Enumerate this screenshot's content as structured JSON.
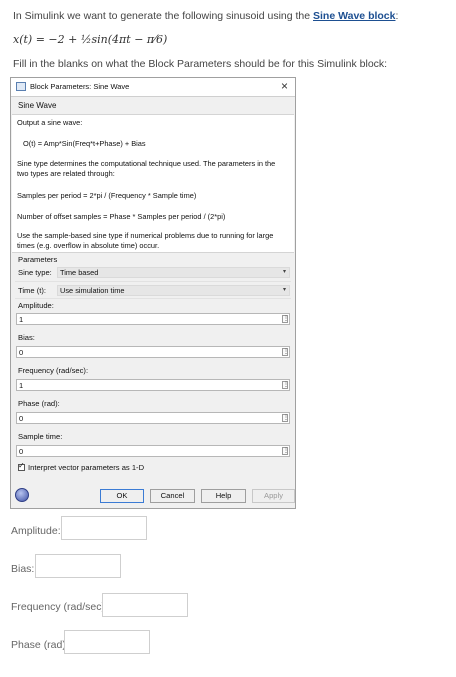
{
  "question": {
    "intro_prefix": "In Simulink we want to generate the following sinusoid using the ",
    "intro_link": "Sine Wave block",
    "intro_suffix": ":",
    "equation": "x(t) = −2 + ½sin(4πt − π⁄6)",
    "instruction": "Fill in the blanks on what the Block Parameters should be for this Simulink block:"
  },
  "dialog": {
    "title": "Block Parameters: Sine Wave",
    "close_glyph": "×",
    "block_name": "Sine Wave",
    "description": {
      "line1": "Output a sine wave:",
      "line2": "O(t) = Amp*Sin(Freq*t+Phase) + Bias",
      "line3": "Sine type determines the computational technique used. The parameters in the two types are related through:",
      "line4": "Samples per period = 2*pi / (Frequency * Sample time)",
      "line5": "Number of offset samples = Phase * Samples per period / (2*pi)",
      "line6": "Use the sample-based sine type if numerical problems due to running for large times (e.g. overflow in absolute time) occur."
    },
    "parameters_heading": "Parameters",
    "sine_type": {
      "label": "Sine type:",
      "value": "Time based"
    },
    "time": {
      "label": "Time (t):",
      "value": "Use simulation time"
    },
    "amplitude": {
      "label": "Amplitude:",
      "value": "1"
    },
    "bias": {
      "label": "Bias:",
      "value": "0"
    },
    "frequency": {
      "label": "Frequency (rad/sec):",
      "value": "1"
    },
    "phase": {
      "label": "Phase (rad):",
      "value": "0"
    },
    "sample_time": {
      "label": "Sample time:",
      "value": "0"
    },
    "checkbox_label": "Interpret vector parameters as 1-D",
    "checkbox_checked": true,
    "buttons": {
      "ok": "OK",
      "cancel": "Cancel",
      "help": "Help",
      "apply": "Apply"
    },
    "kebab_glyph": "⋮",
    "dropdown_glyph": "▾"
  },
  "answers": {
    "amplitude_label": "Amplitude:",
    "bias_label": "Bias:",
    "frequency_label": "Frequency (rad/sec):",
    "phase_label": "Phase (rad):"
  },
  "icons": [
    "app-window-icon",
    "close-icon",
    "dropdown-caret-icon",
    "field-menu-icon",
    "checkbox-icon",
    "help-icon"
  ]
}
